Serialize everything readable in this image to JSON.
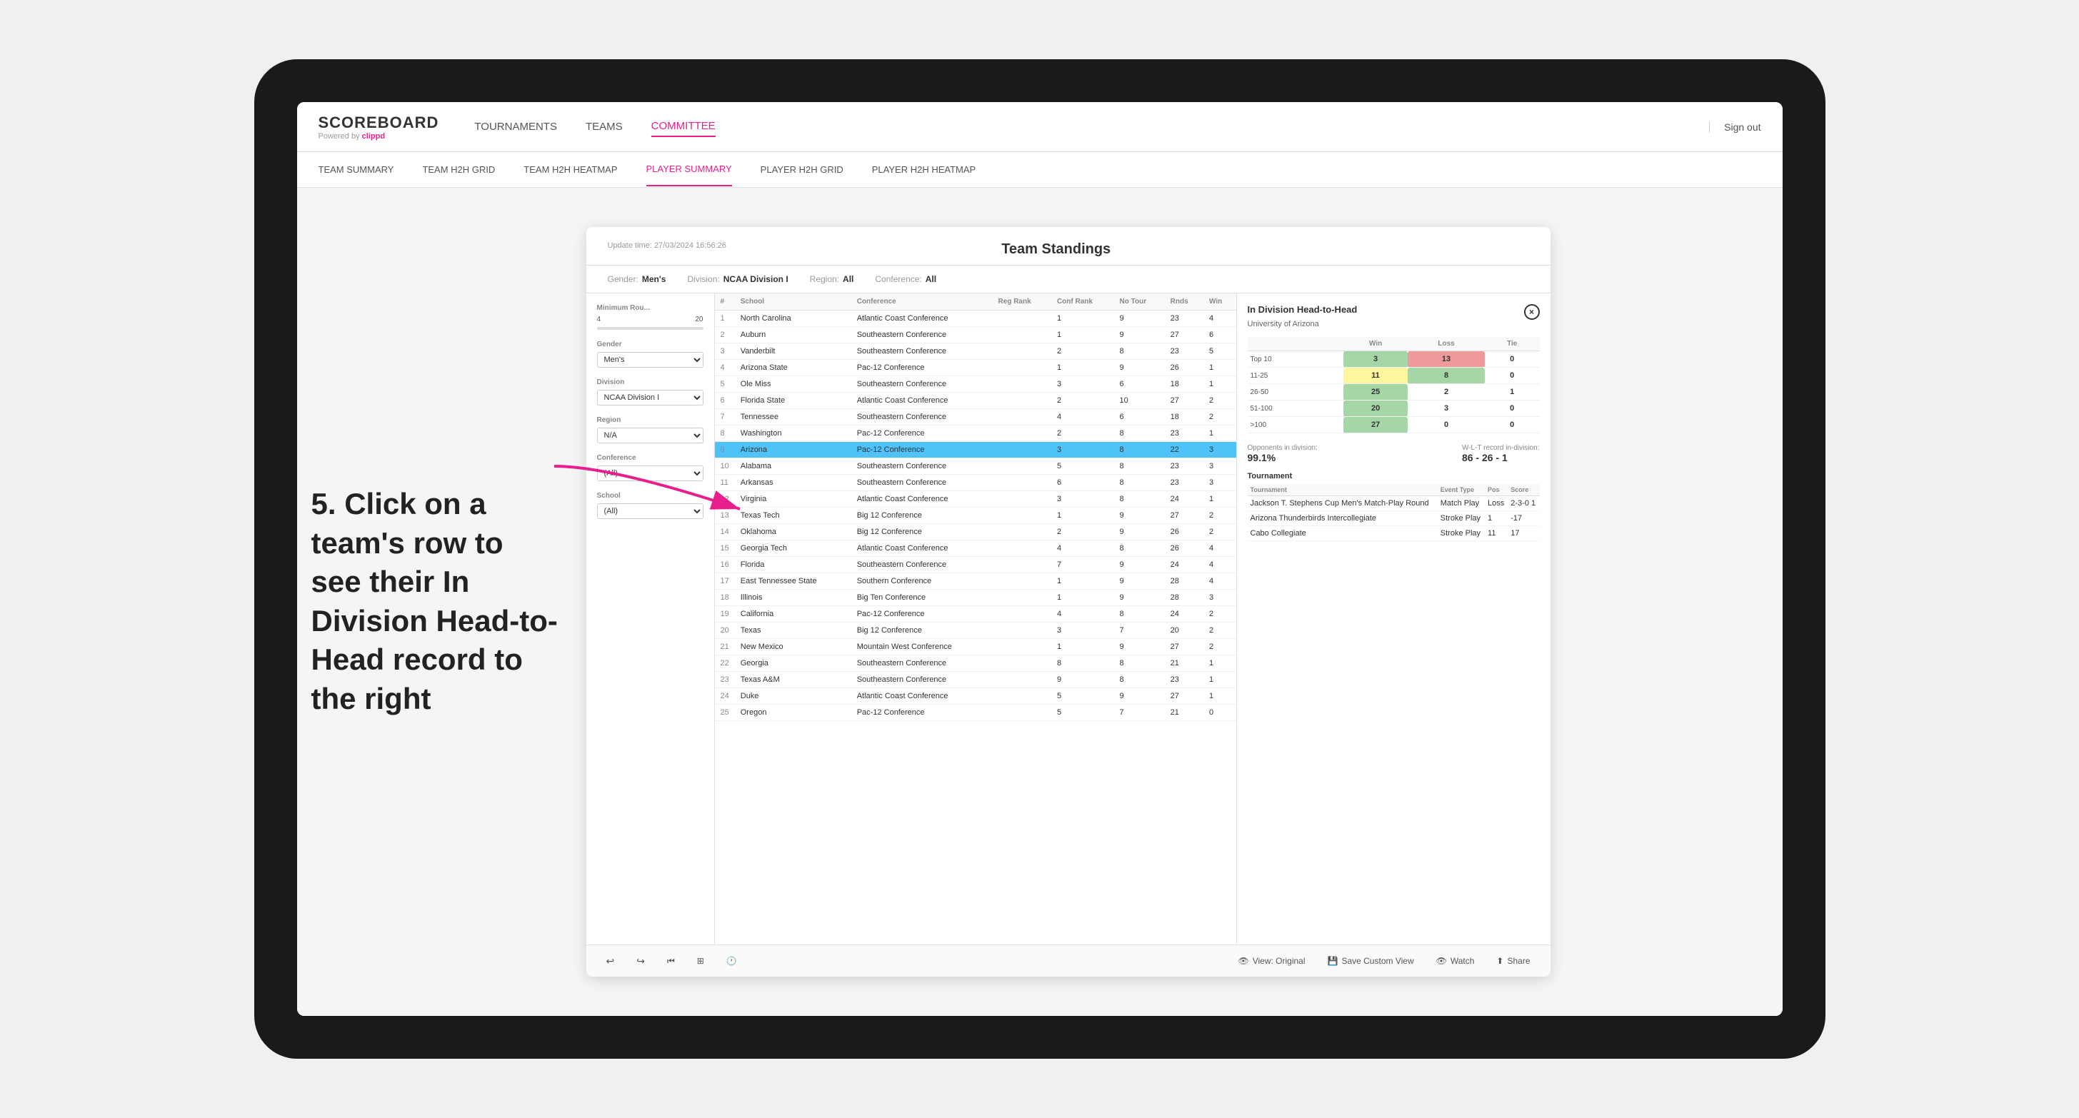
{
  "nav": {
    "logo": "SCOREBOARD",
    "logo_sub": "Powered by ",
    "logo_brand": "clippd",
    "items": [
      "TOURNAMENTS",
      "TEAMS",
      "COMMITTEE"
    ],
    "active_item": "COMMITTEE",
    "sign_out": "Sign out"
  },
  "sub_nav": {
    "items": [
      "TEAM SUMMARY",
      "TEAM H2H GRID",
      "TEAM H2H HEATMAP",
      "PLAYER SUMMARY",
      "PLAYER H2H GRID",
      "PLAYER H2H HEATMAP"
    ],
    "active_item": "PLAYER SUMMARY"
  },
  "annotation": "5. Click on a team's row to see their In Division Head-to-Head record to the right",
  "panel": {
    "title": "Team Standings",
    "update_time": "Update time:",
    "update_date": "27/03/2024 16:56:26",
    "filters": {
      "gender": {
        "label": "Gender:",
        "value": "Men's"
      },
      "division": {
        "label": "Division:",
        "value": "NCAA Division I"
      },
      "region": {
        "label": "Region:",
        "value": "All"
      },
      "conference": {
        "label": "Conference:",
        "value": "All"
      }
    },
    "left_filters": {
      "min_rounds_label": "Minimum Rou...",
      "min_val": "4",
      "max_val": "20",
      "gender_label": "Gender",
      "gender_value": "Men's",
      "division_label": "Division",
      "division_value": "NCAA Division I",
      "region_label": "Region",
      "region_value": "N/A",
      "conference_label": "Conference",
      "conference_value": "(All)",
      "school_label": "School",
      "school_value": "(All)"
    },
    "table": {
      "headers": [
        "#",
        "School",
        "Conference",
        "Reg Rank",
        "Conf Rank",
        "No Tour",
        "Rnds",
        "Win"
      ],
      "rows": [
        {
          "rank": "1",
          "school": "North Carolina",
          "conference": "Atlantic Coast Conference",
          "reg_rank": "",
          "conf_rank": "1",
          "no_tour": "9",
          "rnds": "23",
          "win": "4"
        },
        {
          "rank": "2",
          "school": "Auburn",
          "conference": "Southeastern Conference",
          "reg_rank": "",
          "conf_rank": "1",
          "no_tour": "9",
          "rnds": "27",
          "win": "6"
        },
        {
          "rank": "3",
          "school": "Vanderbilt",
          "conference": "Southeastern Conference",
          "reg_rank": "",
          "conf_rank": "2",
          "no_tour": "8",
          "rnds": "23",
          "win": "5"
        },
        {
          "rank": "4",
          "school": "Arizona State",
          "conference": "Pac-12 Conference",
          "reg_rank": "",
          "conf_rank": "1",
          "no_tour": "9",
          "rnds": "26",
          "win": "1"
        },
        {
          "rank": "5",
          "school": "Ole Miss",
          "conference": "Southeastern Conference",
          "reg_rank": "",
          "conf_rank": "3",
          "no_tour": "6",
          "rnds": "18",
          "win": "1"
        },
        {
          "rank": "6",
          "school": "Florida State",
          "conference": "Atlantic Coast Conference",
          "reg_rank": "",
          "conf_rank": "2",
          "no_tour": "10",
          "rnds": "27",
          "win": "2"
        },
        {
          "rank": "7",
          "school": "Tennessee",
          "conference": "Southeastern Conference",
          "reg_rank": "",
          "conf_rank": "4",
          "no_tour": "6",
          "rnds": "18",
          "win": "2"
        },
        {
          "rank": "8",
          "school": "Washington",
          "conference": "Pac-12 Conference",
          "reg_rank": "",
          "conf_rank": "2",
          "no_tour": "8",
          "rnds": "23",
          "win": "1"
        },
        {
          "rank": "9",
          "school": "Arizona",
          "conference": "Pac-12 Conference",
          "reg_rank": "",
          "conf_rank": "3",
          "no_tour": "8",
          "rnds": "22",
          "win": "3",
          "highlighted": true
        },
        {
          "rank": "10",
          "school": "Alabama",
          "conference": "Southeastern Conference",
          "reg_rank": "",
          "conf_rank": "5",
          "no_tour": "8",
          "rnds": "23",
          "win": "3"
        },
        {
          "rank": "11",
          "school": "Arkansas",
          "conference": "Southeastern Conference",
          "reg_rank": "",
          "conf_rank": "6",
          "no_tour": "8",
          "rnds": "23",
          "win": "3"
        },
        {
          "rank": "12",
          "school": "Virginia",
          "conference": "Atlantic Coast Conference",
          "reg_rank": "",
          "conf_rank": "3",
          "no_tour": "8",
          "rnds": "24",
          "win": "1"
        },
        {
          "rank": "13",
          "school": "Texas Tech",
          "conference": "Big 12 Conference",
          "reg_rank": "",
          "conf_rank": "1",
          "no_tour": "9",
          "rnds": "27",
          "win": "2"
        },
        {
          "rank": "14",
          "school": "Oklahoma",
          "conference": "Big 12 Conference",
          "reg_rank": "",
          "conf_rank": "2",
          "no_tour": "9",
          "rnds": "26",
          "win": "2"
        },
        {
          "rank": "15",
          "school": "Georgia Tech",
          "conference": "Atlantic Coast Conference",
          "reg_rank": "",
          "conf_rank": "4",
          "no_tour": "8",
          "rnds": "26",
          "win": "4"
        },
        {
          "rank": "16",
          "school": "Florida",
          "conference": "Southeastern Conference",
          "reg_rank": "",
          "conf_rank": "7",
          "no_tour": "9",
          "rnds": "24",
          "win": "4"
        },
        {
          "rank": "17",
          "school": "East Tennessee State",
          "conference": "Southern Conference",
          "reg_rank": "",
          "conf_rank": "1",
          "no_tour": "9",
          "rnds": "28",
          "win": "4"
        },
        {
          "rank": "18",
          "school": "Illinois",
          "conference": "Big Ten Conference",
          "reg_rank": "",
          "conf_rank": "1",
          "no_tour": "9",
          "rnds": "28",
          "win": "3"
        },
        {
          "rank": "19",
          "school": "California",
          "conference": "Pac-12 Conference",
          "reg_rank": "",
          "conf_rank": "4",
          "no_tour": "8",
          "rnds": "24",
          "win": "2"
        },
        {
          "rank": "20",
          "school": "Texas",
          "conference": "Big 12 Conference",
          "reg_rank": "",
          "conf_rank": "3",
          "no_tour": "7",
          "rnds": "20",
          "win": "2"
        },
        {
          "rank": "21",
          "school": "New Mexico",
          "conference": "Mountain West Conference",
          "reg_rank": "",
          "conf_rank": "1",
          "no_tour": "9",
          "rnds": "27",
          "win": "2"
        },
        {
          "rank": "22",
          "school": "Georgia",
          "conference": "Southeastern Conference",
          "reg_rank": "",
          "conf_rank": "8",
          "no_tour": "8",
          "rnds": "21",
          "win": "1"
        },
        {
          "rank": "23",
          "school": "Texas A&M",
          "conference": "Southeastern Conference",
          "reg_rank": "",
          "conf_rank": "9",
          "no_tour": "8",
          "rnds": "23",
          "win": "1"
        },
        {
          "rank": "24",
          "school": "Duke",
          "conference": "Atlantic Coast Conference",
          "reg_rank": "",
          "conf_rank": "5",
          "no_tour": "9",
          "rnds": "27",
          "win": "1"
        },
        {
          "rank": "25",
          "school": "Oregon",
          "conference": "Pac-12 Conference",
          "reg_rank": "",
          "conf_rank": "5",
          "no_tour": "7",
          "rnds": "21",
          "win": "0"
        }
      ]
    }
  },
  "h2h": {
    "title": "In Division Head-to-Head",
    "close_label": "×",
    "team": "University of Arizona",
    "table_headers": [
      "",
      "Win",
      "Loss",
      "Tie"
    ],
    "rows": [
      {
        "label": "Top 10",
        "win": "3",
        "loss": "13",
        "tie": "0",
        "win_color": "green",
        "loss_color": "red",
        "tie_color": "gray"
      },
      {
        "label": "11-25",
        "win": "11",
        "loss": "8",
        "tie": "0",
        "win_color": "yellow",
        "loss_color": "green",
        "tie_color": "gray"
      },
      {
        "label": "26-50",
        "win": "25",
        "loss": "2",
        "tie": "1",
        "win_color": "green",
        "loss_color": "gray",
        "tie_color": "gray"
      },
      {
        "label": "51-100",
        "win": "20",
        "loss": "3",
        "tie": "0",
        "win_color": "green",
        "loss_color": "gray",
        "tie_color": "gray"
      },
      {
        "label": ">100",
        "win": "27",
        "loss": "0",
        "tie": "0",
        "win_color": "green",
        "loss_color": "gray",
        "tie_color": "gray"
      }
    ],
    "opponents_pct": "99.1%",
    "wlt_record": "86 - 26 - 1",
    "opponents_label": "Opponents in division:",
    "record_label": "W-L-T record in-division:",
    "tournaments": [
      {
        "name": "Jackson T. Stephens Cup Men's Match-Play Round",
        "type": "Match Play",
        "result": "Loss",
        "score": "2-3-0 1"
      },
      {
        "name": "Arizona Thunderbirds Intercollegiate",
        "type": "Stroke Play",
        "result": "1",
        "score": "-17"
      },
      {
        "name": "Cabo Collegiate",
        "type": "Stroke Play",
        "result": "11",
        "score": "17"
      }
    ],
    "tournament_headers": [
      "Tournament",
      "Event Type",
      "Pos",
      "Score"
    ]
  },
  "toolbar": {
    "undo": "↩",
    "redo": "↪",
    "view_original": "View: Original",
    "save_custom": "Save Custom View",
    "watch": "Watch",
    "share": "Share"
  }
}
